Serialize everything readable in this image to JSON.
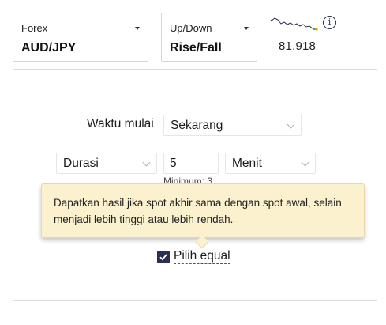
{
  "underlying_selector": {
    "category": "Forex",
    "value": "AUD/JPY"
  },
  "trade_type_selector": {
    "category": "Up/Down",
    "value": "Rise/Fall"
  },
  "spot": {
    "price": "81.918"
  },
  "icons": {
    "info": "info-circle-icon",
    "caret": "caret-down-icon",
    "chevron": "chevron-down-icon",
    "check": "checkmark-icon",
    "sparkline": "sparkline-chart-icon"
  },
  "start_time": {
    "label": "Waktu mulai",
    "selected": "Sekarang"
  },
  "duration": {
    "unit_type_selected": "Durasi",
    "amount": "5",
    "period_selected": "Menit",
    "minimum_note": "Minimum: 3"
  },
  "tooltip": {
    "text": "Dapatkan hasil jika spot akhir sama dengan spot awal, selain menjadi lebih tinggi atau lebih rendah."
  },
  "equal_option": {
    "label": "Pilih equal",
    "checked": true
  },
  "colors": {
    "accent_navy": "#2a3052",
    "tooltip_background": "#fbf1cf",
    "sparkline_line": "#2a3052",
    "sparkline_end_marker": "#f0a000",
    "sparkline_last_tick": "#2bb673"
  }
}
